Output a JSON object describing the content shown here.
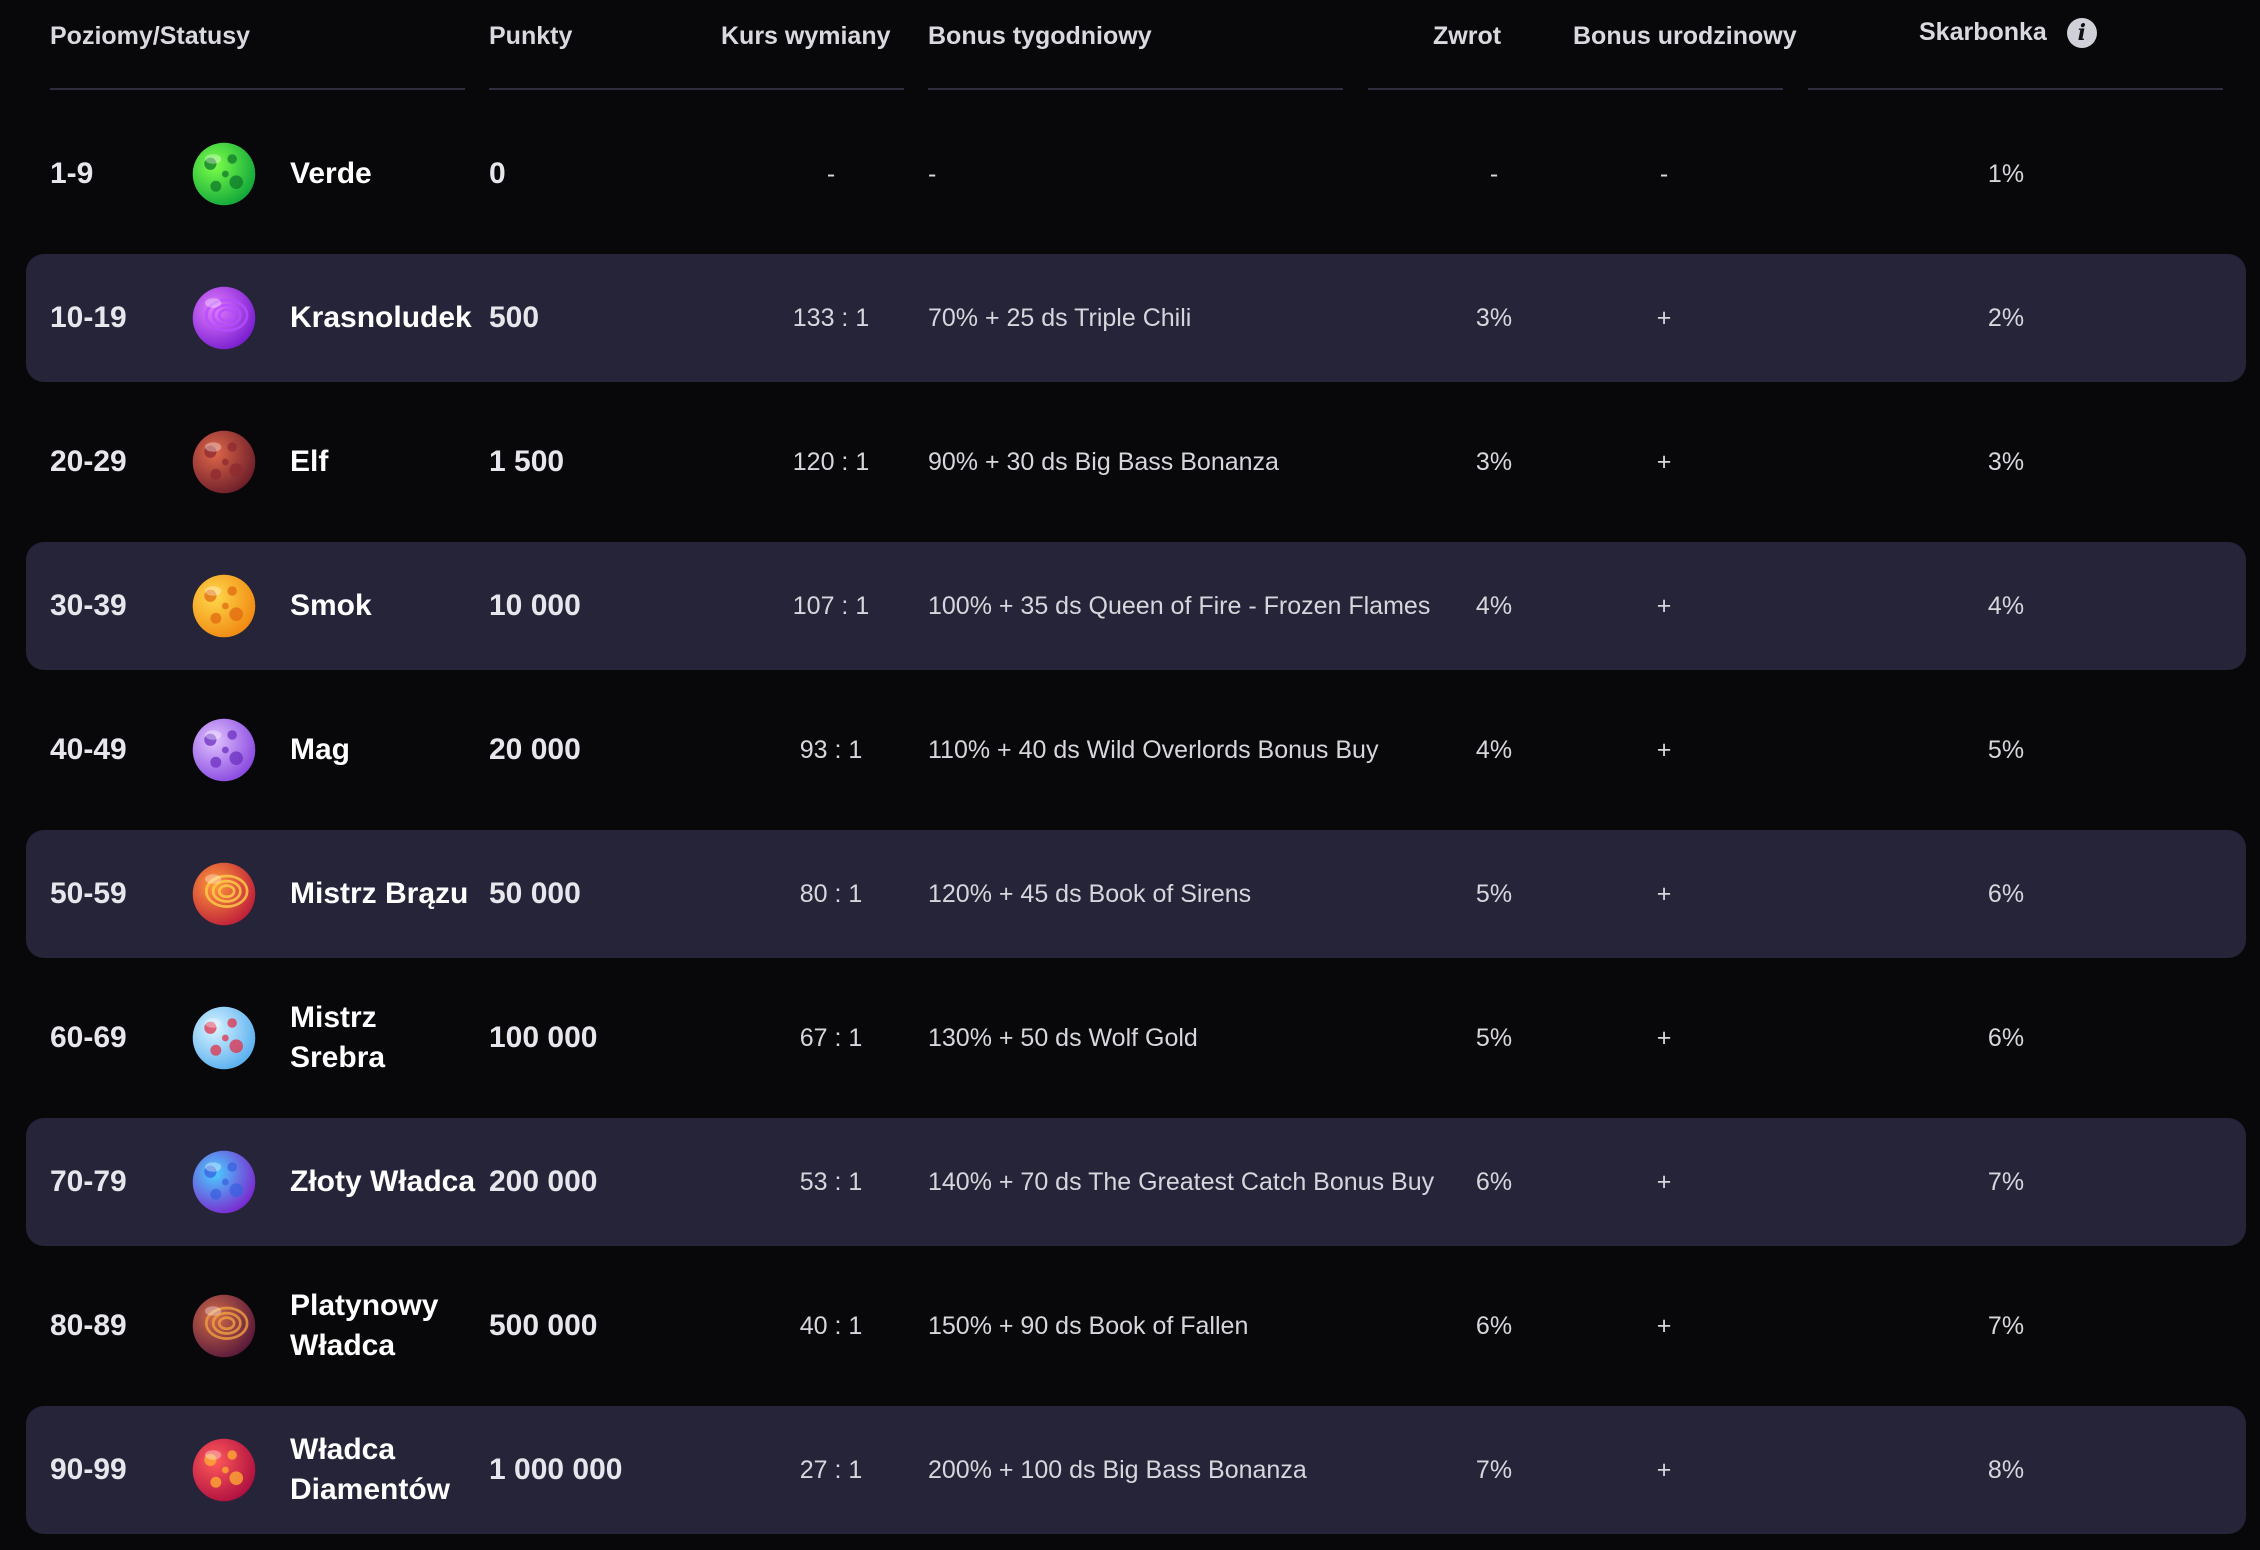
{
  "header": {
    "levels": "Poziomy/Statusy",
    "points": "Punkty",
    "rate": "Kurs wymiany",
    "weekly_bonus": "Bonus tygodniowy",
    "cashback": "Zwrot",
    "birthday_bonus": "Bonus urodzinowy",
    "piggy_bank": "Skarbonka",
    "info_icon": "info-icon"
  },
  "rows": [
    {
      "level": "1-9",
      "name": "Verde",
      "points": "0",
      "rate": "-",
      "bonus": "-",
      "cashback": "-",
      "birthday": "-",
      "piggy": "1%",
      "icon": "planet-green-icon"
    },
    {
      "level": "10-19",
      "name": "Krasnoludek",
      "points": "500",
      "rate": "133 : 1",
      "bonus": "70% + 25 ds Triple Chili",
      "cashback": "3%",
      "birthday": "+",
      "piggy": "2%",
      "icon": "planet-purple-swirl-icon"
    },
    {
      "level": "20-29",
      "name": "Elf",
      "points": "1 500",
      "rate": "120 : 1",
      "bonus": "90% + 30 ds Big Bass Bonanza",
      "cashback": "3%",
      "birthday": "+",
      "piggy": "3%",
      "icon": "planet-rocky-red-icon"
    },
    {
      "level": "30-39",
      "name": "Smok",
      "points": "10 000",
      "rate": "107 : 1",
      "bonus": "100% + 35 ds Queen of Fire - Frozen Flames",
      "cashback": "4%",
      "birthday": "+",
      "piggy": "4%",
      "icon": "planet-golden-icon"
    },
    {
      "level": "40-49",
      "name": "Mag",
      "points": "20 000",
      "rate": "93 : 1",
      "bonus": "110% + 40 ds Wild Overlords Bonus Buy",
      "cashback": "4%",
      "birthday": "+",
      "piggy": "5%",
      "icon": "planet-lavender-icon"
    },
    {
      "level": "50-59",
      "name": "Mistrz Brązu",
      "points": "50 000",
      "rate": "80 : 1",
      "bonus": "120% + 45 ds Book of Sirens",
      "cashback": "5%",
      "birthday": "+",
      "piggy": "6%",
      "icon": "planet-lava-icon"
    },
    {
      "level": "60-69",
      "name": "Mistrz Srebra",
      "points": "100 000",
      "rate": "67 : 1",
      "bonus": "130% + 50 ds Wolf Gold",
      "cashback": "5%",
      "birthday": "+",
      "piggy": "6%",
      "icon": "planet-ice-icon"
    },
    {
      "level": "70-79",
      "name": "Złoty Władca",
      "points": "200 000",
      "rate": "53 : 1",
      "bonus": "140% + 70 ds The Greatest Catch Bonus Buy",
      "cashback": "6%",
      "birthday": "+",
      "piggy": "7%",
      "icon": "planet-blue-purple-icon"
    },
    {
      "level": "80-89",
      "name": "Platynowy Władca",
      "points": "500 000",
      "rate": "40 : 1",
      "bonus": "150% + 90 ds Book of Fallen",
      "cashback": "6%",
      "birthday": "+",
      "piggy": "7%",
      "icon": "planet-cracked-icon"
    },
    {
      "level": "90-99",
      "name": "Władca Diamentów",
      "points": "1 000 000",
      "rate": "27 : 1",
      "bonus": "200% + 100 ds Big Bass Bonanza",
      "cashback": "7%",
      "birthday": "+",
      "piggy": "8%",
      "icon": "planet-red-orb-icon"
    }
  ]
}
